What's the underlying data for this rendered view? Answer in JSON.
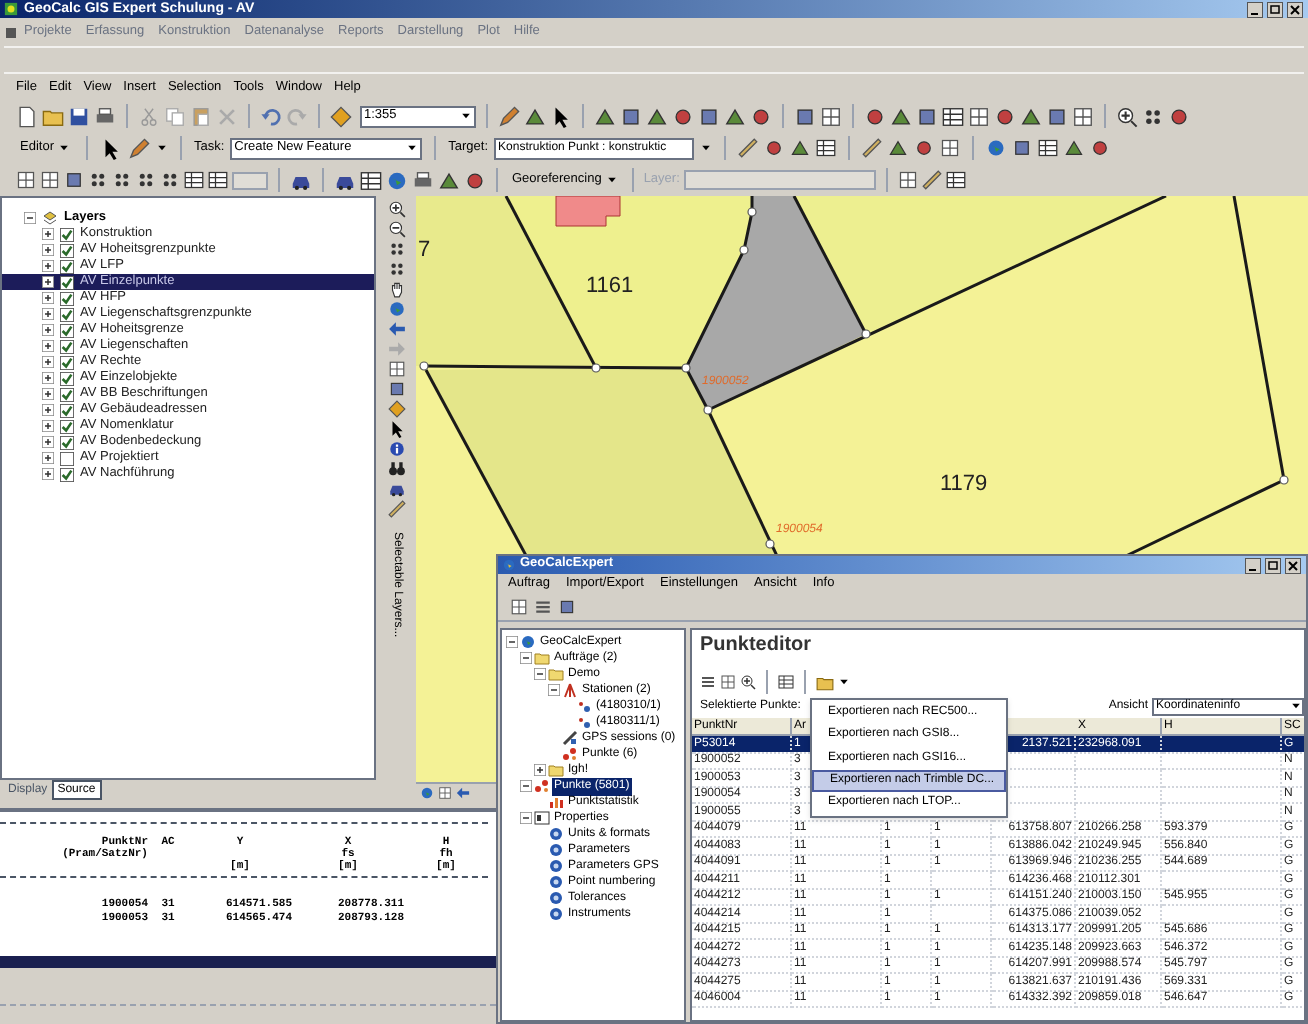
{
  "window": {
    "title": "GeoCalc GIS Expert Schulung - AV"
  },
  "app_menu": [
    "Projekte",
    "Erfassung",
    "Konstruktion",
    "Datenanalyse",
    "Reports",
    "Darstellung",
    "Plot",
    "Hilfe"
  ],
  "menu": [
    "File",
    "Edit",
    "View",
    "Insert",
    "Selection",
    "Tools",
    "Window",
    "Help"
  ],
  "standard_toolbar": {
    "scale": "1:355"
  },
  "editor_toolbar": {
    "editor": "Editor",
    "task_label": "Task:",
    "task": "Create New Feature",
    "target_label": "Target:",
    "target": "Konstruktion Punkt : konstruktic"
  },
  "georef_toolbar": {
    "georeferencing": "Georeferencing",
    "layer_label": "Layer:"
  },
  "toc": {
    "root": {
      "label": "Layers",
      "expanded": true
    },
    "layers": [
      {
        "name": "Konstruktion",
        "checked": true,
        "expanded": false,
        "selected": false
      },
      {
        "name": "AV Hoheitsgrenzpunkte",
        "checked": true,
        "expanded": false,
        "selected": false
      },
      {
        "name": "AV LFP",
        "checked": true,
        "expanded": false,
        "selected": false
      },
      {
        "name": "AV Einzelpunkte",
        "checked": true,
        "expanded": false,
        "selected": true
      },
      {
        "name": "AV HFP",
        "checked": true,
        "expanded": false,
        "selected": false
      },
      {
        "name": "AV Liegenschaftsgrenzpunkte",
        "checked": true,
        "expanded": false,
        "selected": false
      },
      {
        "name": "AV Hoheitsgrenze",
        "checked": true,
        "expanded": false,
        "selected": false
      },
      {
        "name": "AV Liegenschaften",
        "checked": true,
        "expanded": false,
        "selected": false
      },
      {
        "name": "AV Rechte",
        "checked": true,
        "expanded": false,
        "selected": false
      },
      {
        "name": "AV Einzelobjekte",
        "checked": true,
        "expanded": false,
        "selected": false
      },
      {
        "name": "AV BB Beschriftungen",
        "checked": true,
        "expanded": false,
        "selected": false
      },
      {
        "name": "AV Gebäudeadressen",
        "checked": true,
        "expanded": false,
        "selected": false
      },
      {
        "name": "AV Nomenklatur",
        "checked": true,
        "expanded": false,
        "selected": false
      },
      {
        "name": "AV Bodenbedeckung",
        "checked": true,
        "expanded": false,
        "selected": false
      },
      {
        "name": "AV Projektiert",
        "checked": false,
        "expanded": false,
        "selected": false
      },
      {
        "name": "AV Nachführung",
        "checked": true,
        "expanded": false,
        "selected": false
      }
    ],
    "tabs": [
      {
        "label": "Display",
        "selected": false
      },
      {
        "label": "Source",
        "selected": true
      }
    ]
  },
  "tools_panel": {
    "label": "Selectable Layers..."
  },
  "map": {
    "labels": [
      {
        "kind": "parcel",
        "text": "7"
      },
      {
        "kind": "parcel",
        "text": "1161"
      },
      {
        "kind": "parcel",
        "text": "1179"
      },
      {
        "kind": "point",
        "text": "1900052"
      },
      {
        "kind": "point",
        "text": "1900054"
      }
    ]
  },
  "report": {
    "columns": [
      {
        "title": "PunktNr",
        "sub": "(Pram/SatzNr)"
      },
      {
        "title": "AC"
      },
      {
        "title": "Y",
        "unit": "[m]"
      },
      {
        "title": "X",
        "sub": "fs",
        "unit": "[m]"
      },
      {
        "title": "H",
        "sub": "fh",
        "unit": "[m]"
      }
    ],
    "rows": [
      [
        "1900054",
        "31",
        "614571.585",
        "208778.311"
      ],
      [
        "1900053",
        "31",
        "614565.474",
        "208793.128"
      ]
    ]
  },
  "geocalc": {
    "title": "GeoCalcExpert",
    "menu": [
      "Auftrag",
      "Import/Export",
      "Einstellungen",
      "Ansicht",
      "Info"
    ],
    "tree": [
      {
        "label": "GeoCalcExpert",
        "kind": "root",
        "expanded": true,
        "selected": false,
        "children": [
          {
            "label": "Aufträge (2)",
            "kind": "folder",
            "expanded": true,
            "selected": false,
            "children": [
              {
                "label": "Demo",
                "kind": "folder",
                "expanded": true,
                "selected": false,
                "children": [
                  {
                    "label": "Stationen (2)",
                    "kind": "stations",
                    "expanded": true,
                    "selected": false,
                    "children": [
                      {
                        "label": "(4180310/1)",
                        "kind": "station",
                        "selected": false
                      },
                      {
                        "label": "(4180311/1)",
                        "kind": "station",
                        "selected": false
                      }
                    ]
                  },
                  {
                    "label": "GPS sessions (0)",
                    "kind": "gps",
                    "selected": false
                  },
                  {
                    "label": "Punkte (6)",
                    "kind": "points",
                    "selected": false
                  }
                ]
              },
              {
                "label": "Igh!",
                "kind": "folder",
                "expanded": false,
                "selected": false
              }
            ]
          },
          {
            "label": "Punkte (5801)",
            "kind": "points",
            "expanded": true,
            "selected": true,
            "children": [
              {
                "label": "Punktstatistik",
                "kind": "stats",
                "selected": false
              }
            ]
          },
          {
            "label": "Properties",
            "kind": "properties",
            "expanded": true,
            "selected": false,
            "children": [
              {
                "label": "Units & formats",
                "kind": "setting",
                "selected": false
              },
              {
                "label": "Parameters",
                "kind": "setting",
                "selected": false
              },
              {
                "label": "Parameters GPS",
                "kind": "setting",
                "selected": false
              },
              {
                "label": "Point numbering",
                "kind": "setting",
                "selected": false
              },
              {
                "label": "Tolerances",
                "kind": "setting",
                "selected": false
              },
              {
                "label": "Instruments",
                "kind": "setting",
                "selected": false
              }
            ]
          }
        ]
      }
    ],
    "editor": {
      "heading": "Punkteditor",
      "selected_label": "Selektierte Punkte:",
      "view_label": "Ansicht",
      "view": "Koordinateninfo",
      "columns": [
        "PunktNr",
        "Ar",
        null,
        null,
        null,
        "X",
        "H",
        "SC"
      ],
      "rows": [
        {
          "selected": true,
          "cells": [
            "P53014",
            "1",
            null,
            null,
            "2137.521",
            "232968.091",
            null,
            "G"
          ]
        },
        {
          "selected": false,
          "cells": [
            "1900052",
            "3",
            null,
            null,
            null,
            null,
            null,
            "N"
          ]
        },
        {
          "selected": false,
          "cells": [
            "1900053",
            "3",
            null,
            null,
            null,
            null,
            null,
            "N"
          ]
        },
        {
          "selected": false,
          "cells": [
            "1900054",
            "3",
            null,
            null,
            null,
            null,
            null,
            "N"
          ]
        },
        {
          "selected": false,
          "cells": [
            "1900055",
            "3",
            null,
            null,
            null,
            null,
            null,
            "N"
          ]
        },
        {
          "selected": false,
          "cells": [
            "4044079",
            "11",
            "1",
            "1",
            "613758.807",
            "210266.258",
            "593.379",
            "G"
          ]
        },
        {
          "selected": false,
          "cells": [
            "4044083",
            "11",
            "1",
            "1",
            "613886.042",
            "210249.945",
            "556.840",
            "G"
          ]
        },
        {
          "selected": false,
          "cells": [
            "4044091",
            "11",
            "1",
            "1",
            "613969.946",
            "210236.255",
            "544.689",
            "G"
          ]
        },
        {
          "selected": false,
          "cells": [
            "4044211",
            "11",
            "1",
            null,
            "614236.468",
            "210112.301",
            null,
            "G"
          ]
        },
        {
          "selected": false,
          "cells": [
            "4044212",
            "11",
            "1",
            "1",
            "614151.240",
            "210003.150",
            "545.955",
            "G"
          ]
        },
        {
          "selected": false,
          "cells": [
            "4044214",
            "11",
            "1",
            null,
            "614375.086",
            "210039.052",
            null,
            "G"
          ]
        },
        {
          "selected": false,
          "cells": [
            "4044215",
            "11",
            "1",
            "1",
            "614313.177",
            "209991.205",
            "545.686",
            "G"
          ]
        },
        {
          "selected": false,
          "cells": [
            "4044272",
            "11",
            "1",
            "1",
            "614235.148",
            "209923.663",
            "546.372",
            "G"
          ]
        },
        {
          "selected": false,
          "cells": [
            "4044273",
            "11",
            "1",
            "1",
            "614207.991",
            "209988.574",
            "545.797",
            "G"
          ]
        },
        {
          "selected": false,
          "cells": [
            "4044275",
            "11",
            "1",
            "1",
            "613821.637",
            "210191.436",
            "569.331",
            "G"
          ]
        },
        {
          "selected": false,
          "cells": [
            "4046004",
            "11",
            "1",
            "1",
            "614332.392",
            "209859.018",
            "546.647",
            "G"
          ]
        }
      ]
    },
    "export_menu": [
      {
        "label": "Exportieren nach REC500...",
        "selected": false
      },
      {
        "label": "Exportieren nach GSI8...",
        "selected": false
      },
      {
        "label": "Exportieren nach GSI16...",
        "selected": false
      },
      {
        "label": "Exportieren nach Trimble DC...",
        "selected": true
      },
      {
        "label": "Exportieren nach LTOP...",
        "selected": false
      }
    ]
  }
}
